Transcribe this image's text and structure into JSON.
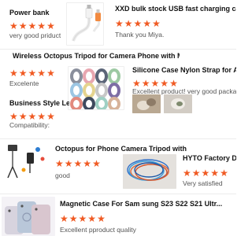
{
  "accent_color": "#f05a23",
  "star_icon": "star-icon",
  "reviews": [
    {
      "title": "Power bank",
      "comment": "very good priduct",
      "rating": 5
    },
    {
      "title": "XXD bulk stock USB fast charging cable wi",
      "comment": "Thank you Miya.",
      "rating": 5
    },
    {
      "title": "Wireless Octopus Tripod for Camera Phone with Micr...",
      "comment": "Excelente",
      "rating": 5
    },
    {
      "title": "Silicone Case Nylon Strap for A",
      "comment": "Excellent product! very good packag",
      "rating": 5
    },
    {
      "title": "Business Style Le",
      "comment": "Compatibility:",
      "rating": 5
    },
    {
      "title": "Octopus for Phone Camera Tripod with Filling l",
      "comment": "good",
      "rating": 5
    },
    {
      "title": "HYTO Factory Dire",
      "comment": "Very satisfied",
      "rating": 5
    },
    {
      "title": "Magnetic Case For Sam sung S23 S22 S21 Ultr...",
      "comment": "Excellent pproduct quality",
      "rating": 5
    }
  ]
}
